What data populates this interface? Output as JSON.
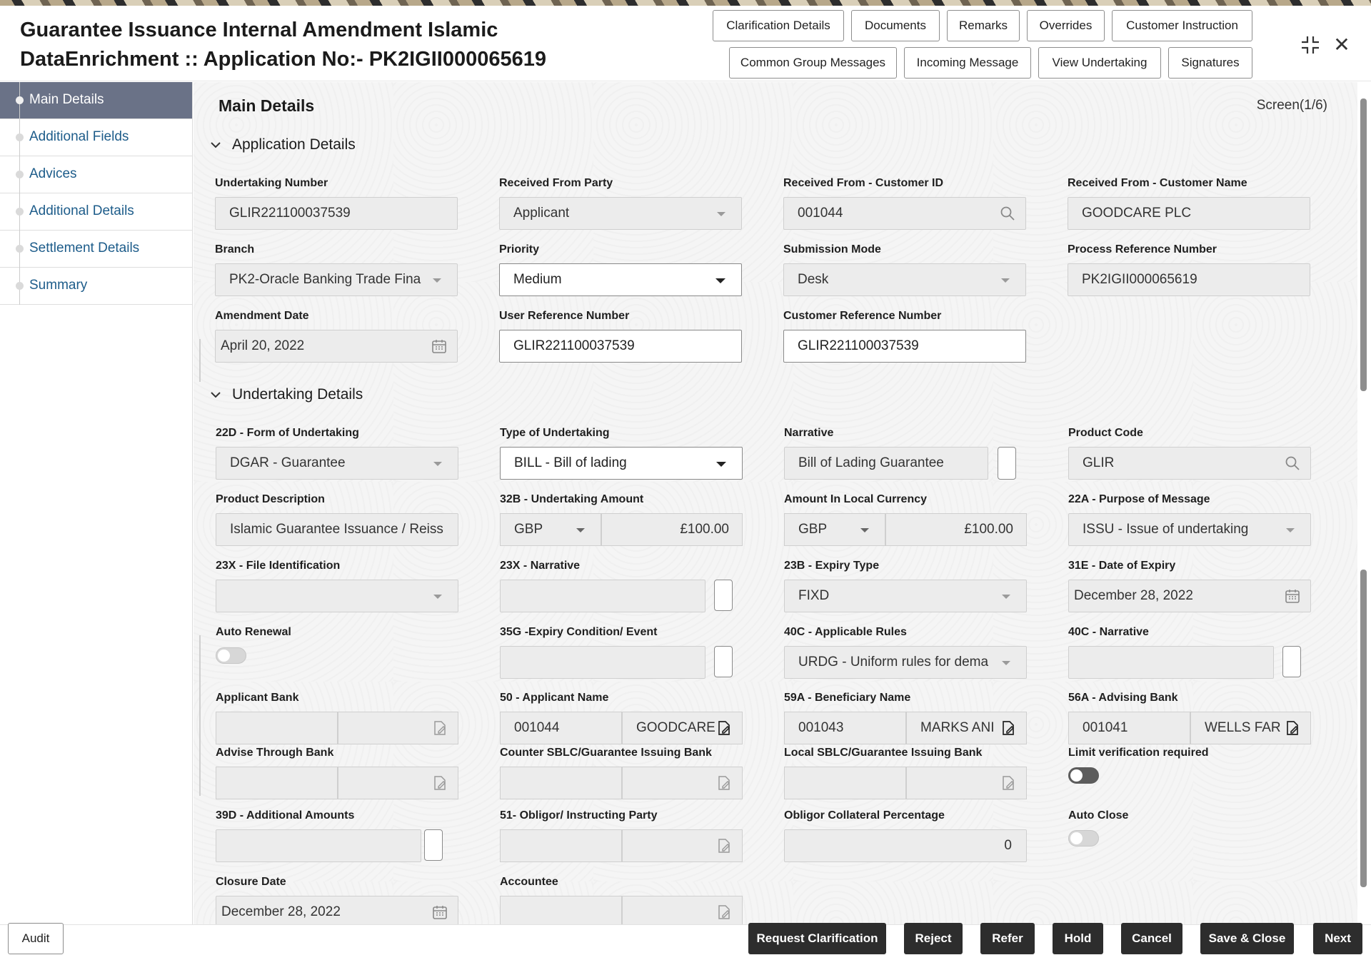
{
  "header": {
    "title": "Guarantee Issuance Internal Amendment Islamic DataEnrichment :: Application No:- PK2IGII000065619",
    "buttons_row1": [
      "Clarification Details",
      "Documents",
      "Remarks",
      "Overrides",
      "Customer Instruction"
    ],
    "buttons_row2": [
      "Common Group Messages",
      "Incoming Message",
      "View Undertaking",
      "Signatures"
    ]
  },
  "sidebar": {
    "items": [
      {
        "label": "Main Details",
        "active": true
      },
      {
        "label": "Additional Fields",
        "active": false
      },
      {
        "label": "Advices",
        "active": false
      },
      {
        "label": "Additional Details",
        "active": false
      },
      {
        "label": "Settlement Details",
        "active": false
      },
      {
        "label": "Summary",
        "active": false
      }
    ]
  },
  "main": {
    "title": "Main Details",
    "screen": "Screen(1/6)",
    "section1": "Application Details",
    "section2": "Undertaking Details"
  },
  "fields": {
    "undertaking_number": {
      "label": "Undertaking Number",
      "value": "GLIR221100037539"
    },
    "received_from_party": {
      "label": "Received From Party",
      "value": "Applicant"
    },
    "customer_id": {
      "label": "Received From - Customer ID",
      "value": "001044"
    },
    "customer_name": {
      "label": "Received From - Customer Name",
      "value": "GOODCARE PLC"
    },
    "branch": {
      "label": "Branch",
      "value": "PK2-Oracle Banking Trade Fina"
    },
    "priority": {
      "label": "Priority",
      "value": "Medium"
    },
    "submission_mode": {
      "label": "Submission Mode",
      "value": "Desk"
    },
    "process_ref": {
      "label": "Process Reference Number",
      "value": "PK2IGII000065619"
    },
    "amendment_date": {
      "label": "Amendment Date",
      "value": "April 20, 2022"
    },
    "user_ref": {
      "label": "User Reference Number",
      "value": "GLIR221100037539"
    },
    "customer_ref": {
      "label": "Customer Reference Number",
      "value": "GLIR221100037539"
    },
    "form_of_undertaking": {
      "label": "22D - Form of Undertaking",
      "value": "DGAR - Guarantee"
    },
    "type_of_undertaking": {
      "label": "Type of Undertaking",
      "value": "BILL - Bill of lading"
    },
    "narrative": {
      "label": "Narrative",
      "value": "Bill of Lading Guarantee"
    },
    "product_code": {
      "label": "Product Code",
      "value": "GLIR"
    },
    "product_description": {
      "label": "Product Description",
      "value": "Islamic  Guarantee Issuance / Reiss"
    },
    "undertaking_amount": {
      "label": "32B - Undertaking Amount",
      "currency": "GBP",
      "value": "£100.00"
    },
    "local_amount": {
      "label": "Amount In Local Currency",
      "currency": "GBP",
      "value": "£100.00"
    },
    "purpose_of_message": {
      "label": "22A - Purpose of Message",
      "value": "ISSU - Issue of undertaking"
    },
    "file_identification": {
      "label": "23X - File Identification",
      "value": ""
    },
    "narrative_23x": {
      "label": "23X - Narrative",
      "value": ""
    },
    "expiry_type": {
      "label": "23B - Expiry Type",
      "value": "FIXD"
    },
    "date_of_expiry": {
      "label": "31E - Date of Expiry",
      "value": "December 28, 2022"
    },
    "auto_renewal": {
      "label": "Auto Renewal"
    },
    "expiry_condition": {
      "label": "35G -Expiry Condition/ Event",
      "value": ""
    },
    "applicable_rules": {
      "label": "40C - Applicable Rules",
      "value": "URDG - Uniform rules for dema"
    },
    "narrative_40c": {
      "label": "40C - Narrative",
      "value": ""
    },
    "applicant_bank": {
      "label": "Applicant Bank",
      "id": "",
      "name": ""
    },
    "applicant_name": {
      "label": "50 - Applicant Name",
      "id": "001044",
      "name": "GOODCARE"
    },
    "beneficiary_name": {
      "label": "59A - Beneficiary Name",
      "id": "001043",
      "name": "MARKS ANI"
    },
    "advising_bank": {
      "label": "56A - Advising Bank",
      "id": "001041",
      "name": "WELLS FAR"
    },
    "advise_through_bank": {
      "label": "Advise Through Bank"
    },
    "counter_sblc": {
      "label": "Counter SBLC/Guarantee Issuing Bank"
    },
    "local_sblc": {
      "label": "Local SBLC/Guarantee Issuing Bank"
    },
    "limit_verification": {
      "label": "Limit verification required"
    },
    "additional_amounts": {
      "label": "39D - Additional Amounts",
      "value": ""
    },
    "obligor": {
      "label": "51- Obligor/ Instructing Party"
    },
    "obligor_collateral": {
      "label": "Obligor Collateral Percentage",
      "value": "0"
    },
    "auto_close": {
      "label": "Auto Close"
    },
    "closure_date": {
      "label": "Closure Date",
      "value": "December 28, 2022"
    },
    "accountee": {
      "label": "Accountee"
    }
  },
  "footer": {
    "audit": "Audit",
    "buttons": [
      "Request Clarification",
      "Reject",
      "Refer",
      "Hold",
      "Cancel",
      "Save & Close",
      "Next"
    ]
  }
}
